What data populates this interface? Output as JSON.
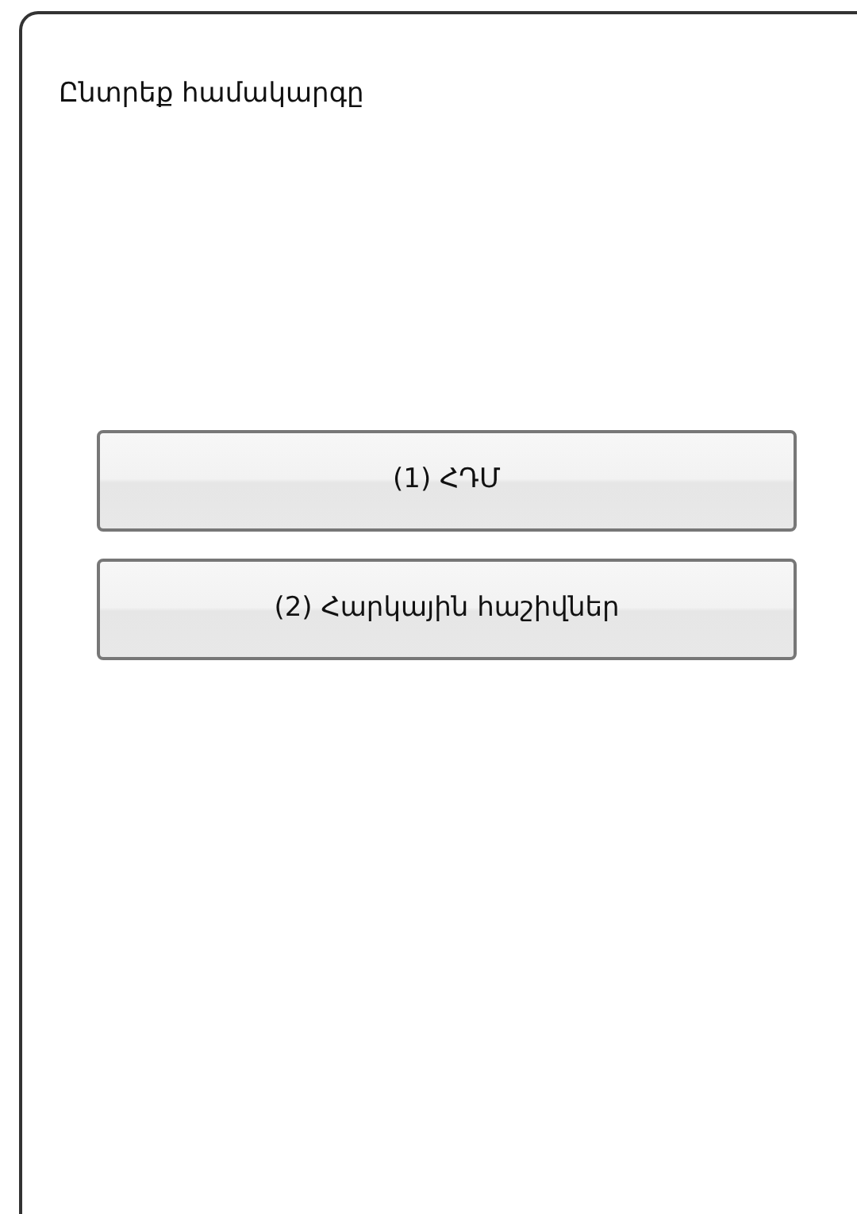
{
  "title": "Ընտրեք համակարգը",
  "buttons": [
    "(1) ՀԴՄ",
    "(2) Հարկային հաշիվներ"
  ]
}
